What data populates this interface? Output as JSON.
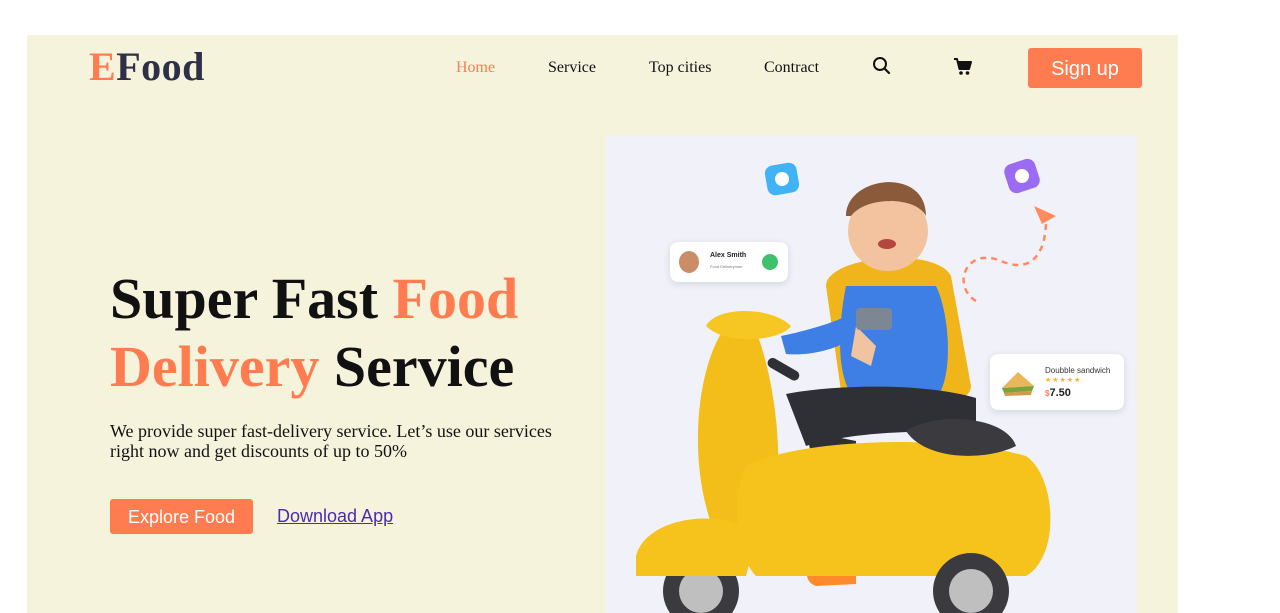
{
  "brand": {
    "logo_first": "E",
    "logo_rest": "Food"
  },
  "nav": {
    "items": [
      {
        "label": "Home",
        "active": true
      },
      {
        "label": "Service",
        "active": false
      },
      {
        "label": "Top cities",
        "active": false
      },
      {
        "label": "Contract",
        "active": false
      }
    ],
    "search_icon": "search-icon",
    "cart_icon": "cart-icon",
    "signup_label": "Sign up"
  },
  "hero": {
    "title_part1": "Super Fast ",
    "title_accent1": "Food",
    "title_accent2": "Delivery",
    "title_part2": " Service",
    "description": "We provide super fast-delivery service. Let’s use our services right now and get discounts of up to 50%",
    "explore_label": "Explore Food",
    "download_label": "Download App"
  },
  "illustration": {
    "contact_card": {
      "name": "Alex Smith",
      "role": "Food Deliveryman"
    },
    "product_card": {
      "name": "Doubble sandwich",
      "currency": "$",
      "price": "7.50",
      "rating": 5
    }
  },
  "colors": {
    "accent": "#ff7b50",
    "page_bg": "#f5f3dc",
    "dark_text": "#2d3047"
  }
}
